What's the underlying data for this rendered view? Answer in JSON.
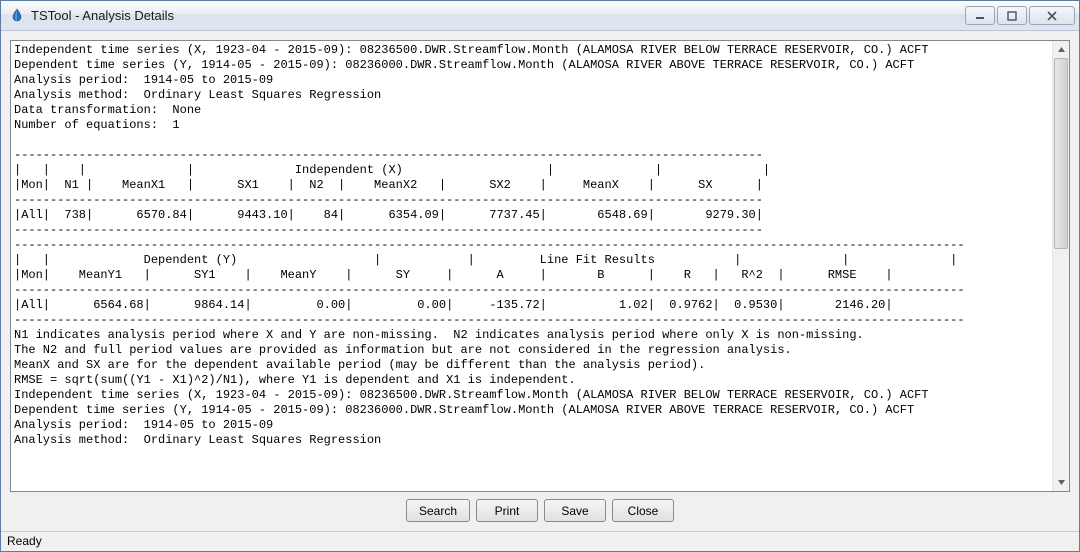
{
  "window": {
    "title": "TSTool - Analysis Details"
  },
  "analysis": {
    "independent_series_line": "Independent time series (X, 1923-04 - 2015-09): 08236500.DWR.Streamflow.Month (ALAMOSA RIVER BELOW TERRACE RESERVOIR, CO.) ACFT",
    "dependent_series_line": "Dependent time series (Y, 1914-05 - 2015-09): 08236000.DWR.Streamflow.Month (ALAMOSA RIVER ABOVE TERRACE RESERVOIR, CO.) ACFT",
    "period_line": "Analysis period:  1914-05 to 2015-09",
    "method_line": "Analysis method:  Ordinary Least Squares Regression",
    "transform_line": "Data transformation:  None",
    "equations_line": "Number of equations:  1",
    "table1_header1": "|   |    |              |              Independent (X)                    |              |              |",
    "table1_header2": "|Mon|  N1 |    MeanX1   |      SX1    |  N2  |    MeanX2   |      SX2    |     MeanX    |      SX      |",
    "table1_row": "|All|  738|      6570.84|      9443.10|    84|      6354.09|      7737.45|       6548.69|       9279.30|",
    "table2_header1": "|   |             Dependent (Y)                   |            |         Line Fit Results           |              |              |",
    "table2_header2": "|Mon|    MeanY1   |      SY1    |    MeanY    |      SY     |      A     |       B      |    R   |   R^2  |      RMSE    |",
    "table2_row": "|All|      6564.68|      9864.14|         0.00|         0.00|     -135.72|          1.02|  0.9762|  0.9530|       2146.20|",
    "notes1": "N1 indicates analysis period where X and Y are non-missing.  N2 indicates analysis period where only X is non-missing.",
    "notes2": "The N2 and full period values are provided as information but are not considered in the regression analysis.",
    "notes3": "MeanX and SX are for the dependent available period (may be different than the analysis period).",
    "notes4": "RMSE = sqrt(sum((Y1 - X1)^2)/N1), where Y1 is dependent and X1 is independent.",
    "dash104": "--------------------------------------------------------------------------------------------------------",
    "dash132": "------------------------------------------------------------------------------------------------------------------------------------"
  },
  "buttons": {
    "search": "Search",
    "print": "Print",
    "save": "Save",
    "close": "Close"
  },
  "status": {
    "text": "Ready"
  }
}
